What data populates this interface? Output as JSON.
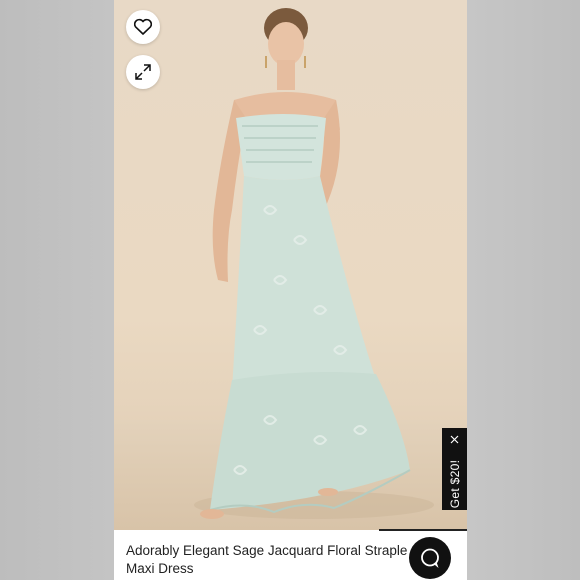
{
  "product": {
    "title": "Adorably Elegant Sage Jacquard Floral Strapless Maxi Dress",
    "title_line1": "Adorably Elegant Sage Jacquard Floral Straple",
    "title_line2": "Maxi Dress"
  },
  "actions": {
    "favorite_icon": "heart-icon",
    "expand_icon": "expand-icon",
    "chat_icon": "chat-bubble-icon"
  },
  "promo": {
    "label": "Get $20!",
    "close_icon": "close-icon"
  },
  "colors": {
    "dress": "#cfe1d8",
    "backdrop": "#e8d9c6",
    "promo_bg": "#111111"
  }
}
